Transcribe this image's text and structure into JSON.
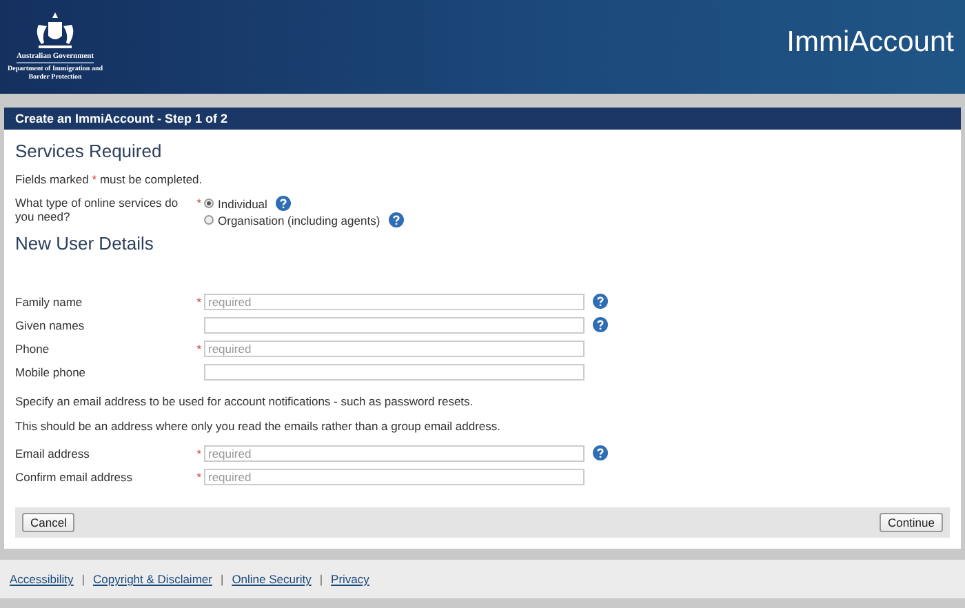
{
  "header": {
    "agency_name": "Australian Government",
    "department": "Department of Immigration and Border Protection",
    "site_title": "ImmiAccount"
  },
  "panel_title": "Create an ImmiAccount - Step 1 of 2",
  "services": {
    "heading": "Services Required",
    "note_before": "Fields marked",
    "note_mark": "*",
    "note_after": "must be completed.",
    "question": "What type of online services do you need?",
    "required": true,
    "options": [
      {
        "label": "Individual",
        "selected": true,
        "help": true
      },
      {
        "label": "Organisation (including agents)",
        "selected": false,
        "help": true
      }
    ]
  },
  "user_details": {
    "heading": "New User Details",
    "fields": [
      {
        "label": "Family name",
        "required": true,
        "placeholder": "required",
        "help": true
      },
      {
        "label": "Given names",
        "required": false,
        "help": true
      },
      {
        "label": "Phone",
        "required": true,
        "placeholder": "required",
        "help": false
      },
      {
        "label": "Mobile phone",
        "required": false,
        "help": false
      }
    ]
  },
  "email_notes": [
    "Specify an email address to be used for account notifications - such as password resets.",
    "This should be an address where only you read the emails rather than a group email address."
  ],
  "email_fields": [
    {
      "label": "Email address",
      "required": true,
      "placeholder": "required",
      "help": true
    },
    {
      "label": "Confirm email address",
      "required": true,
      "placeholder": "required",
      "help": false
    }
  ],
  "buttons": {
    "cancel": "Cancel",
    "continue": "Continue"
  },
  "footer_separator": "|",
  "footer_links": [
    "Accessibility",
    "Copyright & Disclaimer",
    "Online Security",
    "Privacy"
  ]
}
